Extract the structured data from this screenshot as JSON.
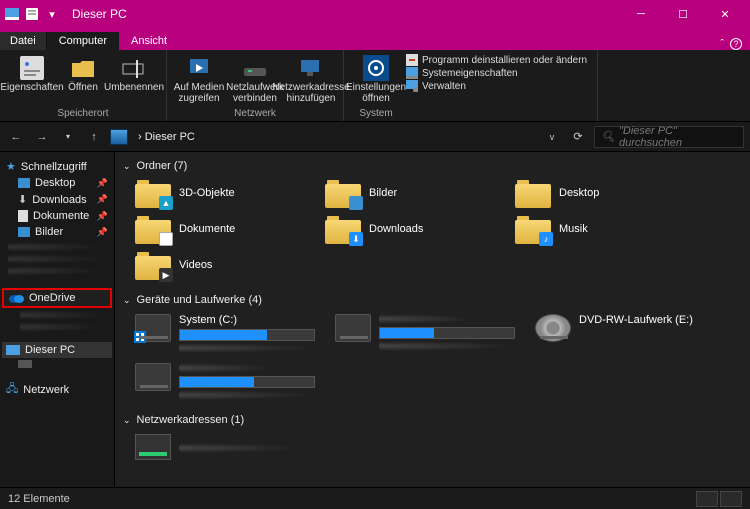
{
  "window": {
    "title": "Dieser PC"
  },
  "tabs": {
    "file": "Datei",
    "computer": "Computer",
    "view": "Ansicht"
  },
  "ribbon": {
    "storage": {
      "group": "Speicherort",
      "properties": "Eigenschaften",
      "open": "Öffnen",
      "rename": "Umbenennen"
    },
    "network": {
      "group": "Netzwerk",
      "media": "Auf Medien zugreifen",
      "mapdrive": "Netzlaufwerk verbinden",
      "addaddress": "Netzwerkadresse hinzufügen"
    },
    "system": {
      "group": "System",
      "settings": "Einstellungen öffnen",
      "uninstall": "Programm deinstallieren oder ändern",
      "sysprops": "Systemeigenschaften",
      "manage": "Verwalten"
    }
  },
  "address": {
    "location": "Dieser PC",
    "search_placeholder": "\"Dieser PC\" durchsuchen"
  },
  "nav": {
    "quickaccess": "Schnellzugriff",
    "desktop": "Desktop",
    "downloads": "Downloads",
    "documents": "Dokumente",
    "pictures": "Bilder",
    "onedrive": "OneDrive",
    "thispc": "Dieser PC",
    "network": "Netzwerk"
  },
  "sections": {
    "folders": "Ordner (7)",
    "drives": "Geräte und Laufwerke (4)",
    "netaddr": "Netzwerkadressen (1)"
  },
  "folders": {
    "objects3d": "3D-Objekte",
    "pictures": "Bilder",
    "desktop": "Desktop",
    "documents": "Dokumente",
    "downloads": "Downloads",
    "music": "Musik",
    "videos": "Videos"
  },
  "drives_data": {
    "system": {
      "name": "System (C:)",
      "fill_pct": 65
    },
    "d2": {
      "name": "",
      "fill_pct": 40
    },
    "d3": {
      "name": "",
      "fill_pct": 55
    },
    "dvd": {
      "name": "DVD-RW-Laufwerk (E:)"
    }
  },
  "status": {
    "count": "12 Elemente"
  }
}
